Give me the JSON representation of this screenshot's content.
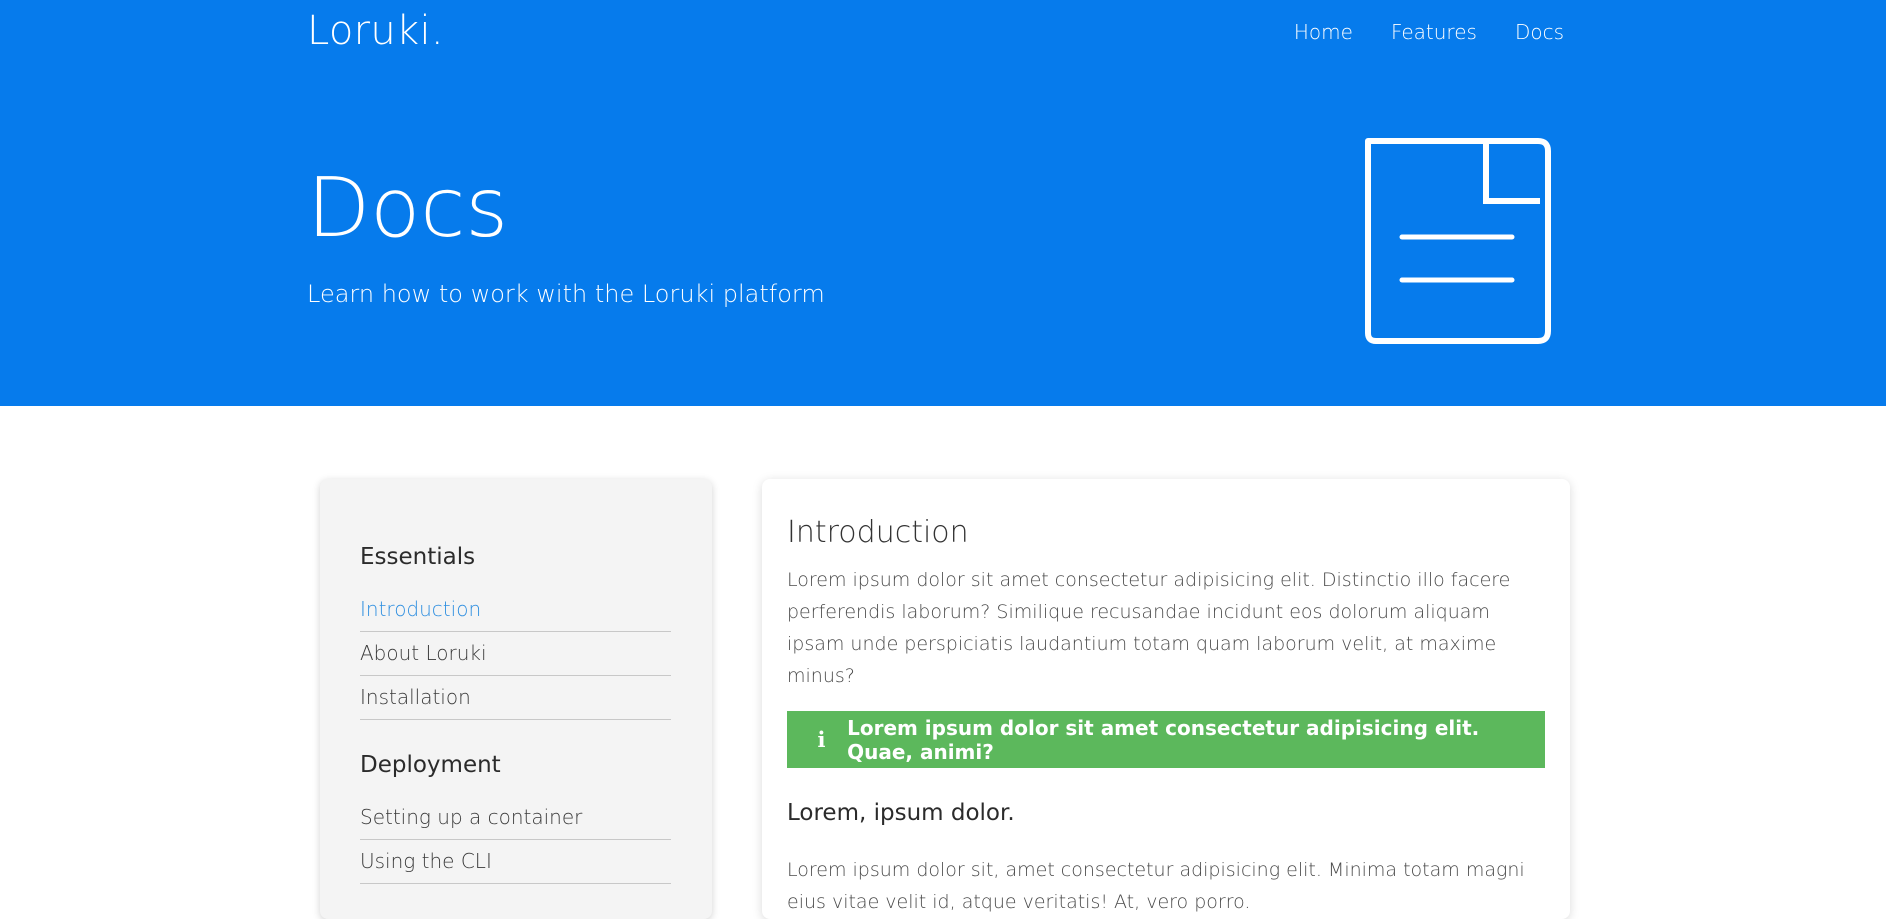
{
  "header": {
    "brand": "Loruki.",
    "nav": [
      {
        "label": "Home"
      },
      {
        "label": "Features"
      },
      {
        "label": "Docs"
      }
    ]
  },
  "hero": {
    "title": "Docs",
    "subtitle": "Learn how to work with the Loruki platform",
    "icon": "document-icon"
  },
  "sidebar": {
    "groups": [
      {
        "title": "Essentials",
        "items": [
          {
            "label": "Introduction",
            "active": true
          },
          {
            "label": "About Loruki"
          },
          {
            "label": "Installation"
          }
        ]
      },
      {
        "title": "Deployment",
        "items": [
          {
            "label": "Setting up a container"
          },
          {
            "label": "Using the CLI"
          }
        ]
      }
    ]
  },
  "main": {
    "title": "Introduction",
    "intro": "Lorem ipsum dolor sit amet consectetur adipisicing elit. Distinctio illo facere perferendis laborum? Similique recusandae incidunt eos dolorum aliquam ipsam unde perspiciatis laudantium totam quam laborum velit, at maxime minus?",
    "alert": {
      "icon": "info-icon",
      "text": "Lorem ipsum dolor sit amet consectetur adipisicing elit. Quae, animi?"
    },
    "subheading": "Lorem, ipsum dolor.",
    "body": "Lorem ipsum dolor sit, amet consectetur adipisicing elit. Minima totam magni eius vitae velit id, atque veritatis! At, vero porro."
  },
  "colors": {
    "primary": "#067bec",
    "success": "#5cb85c",
    "sidebar_bg": "#f4f4f4",
    "active_link": "#2f8fe0"
  }
}
